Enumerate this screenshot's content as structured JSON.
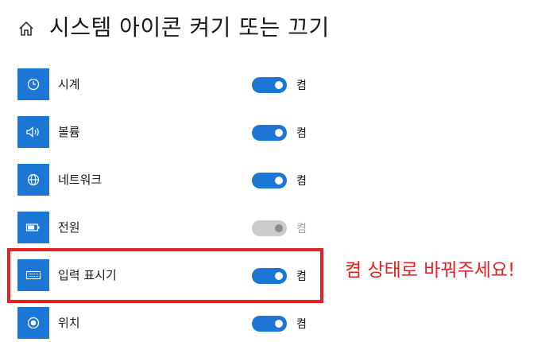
{
  "header": {
    "title": "시스템 아이콘 켜기 또는 끄기"
  },
  "items": [
    {
      "label": "시계",
      "icon": "clock-icon",
      "state": "켬",
      "enabled": true
    },
    {
      "label": "볼륨",
      "icon": "volume-icon",
      "state": "켬",
      "enabled": true
    },
    {
      "label": "네트워크",
      "icon": "network-icon",
      "state": "켬",
      "enabled": true
    },
    {
      "label": "전원",
      "icon": "battery-icon",
      "state": "켬",
      "enabled": false
    },
    {
      "label": "입력 표시기",
      "icon": "keyboard-icon",
      "state": "켬",
      "enabled": true
    },
    {
      "label": "위치",
      "icon": "location-icon",
      "state": "켬",
      "enabled": true
    }
  ],
  "annotation": {
    "text": "켬 상태로 바꿔주세요!",
    "color": "#e52222"
  },
  "colors": {
    "accent": "#1b77d3",
    "toggle_disabled": "#cccccc",
    "annotation_red": "#e52222"
  }
}
